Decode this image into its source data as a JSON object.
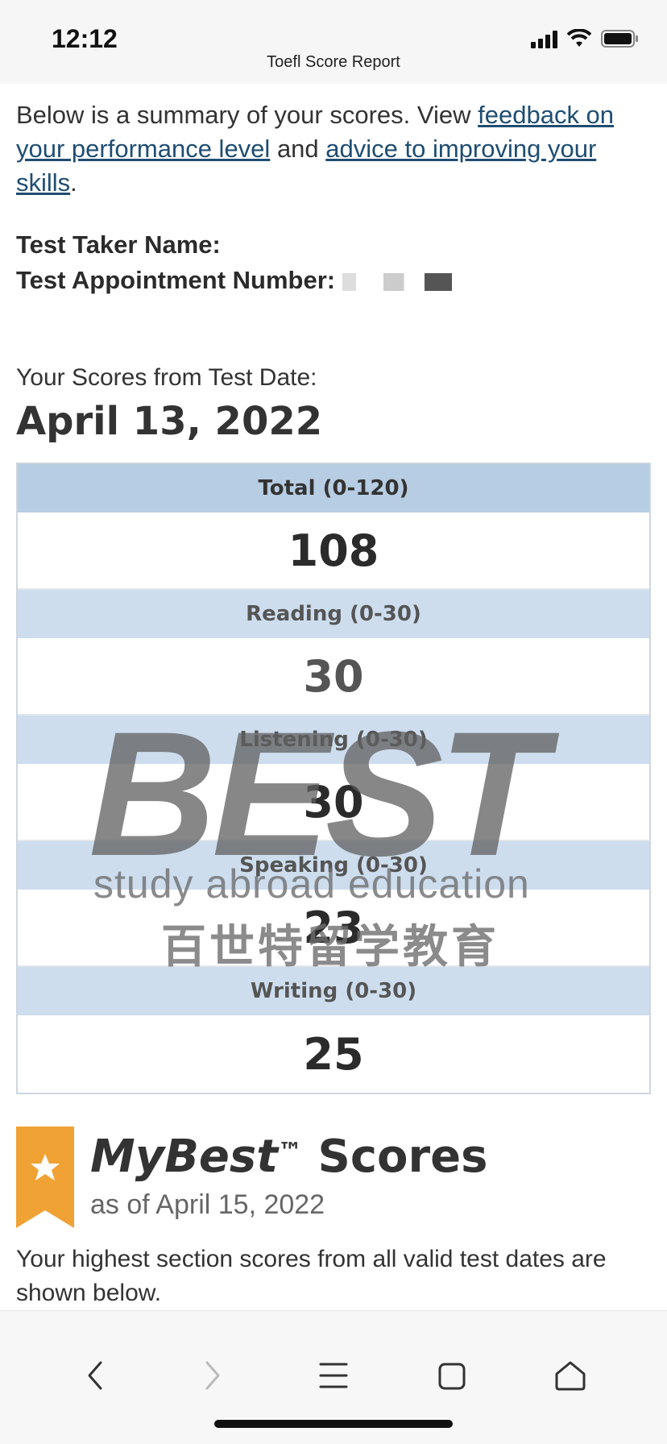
{
  "status": {
    "time": "12:12"
  },
  "browser": {
    "title": "Toefl Score Report"
  },
  "intro": {
    "text_before": "Below is a summary of your scores. View ",
    "link1": "feedback on your performance level",
    "text_mid": " and ",
    "link2": "advice to improving your skills",
    "text_end": "."
  },
  "taker": {
    "name_label": "Test Taker Name:",
    "appointment_label": "Test Appointment Number:"
  },
  "scores": {
    "from_label": "Your Scores from Test Date:",
    "test_date": "April 13, 2022",
    "total": {
      "label": "Total (0-120)",
      "value": "108"
    },
    "reading": {
      "label": "Reading (0-30)",
      "value": "30"
    },
    "listening": {
      "label": "Listening (0-30)",
      "value": "30"
    },
    "speaking": {
      "label": "Speaking (0-30)",
      "value": "23"
    },
    "writing": {
      "label": "Writing (0-30)",
      "value": "25"
    }
  },
  "watermark": {
    "big": "BEST",
    "en": "study abroad education",
    "cn": "百世特留学教育"
  },
  "mybest": {
    "title_italic": "MyBest",
    "tm": "™",
    "title_rest": " Scores",
    "as_of": "as of April 15, 2022",
    "description": "Your highest section scores from all valid test dates are shown below."
  },
  "toolbar": {
    "icons": [
      "back-icon",
      "forward-icon",
      "menu-icon",
      "tabs-icon",
      "home-icon"
    ]
  },
  "colors": {
    "header_band": "#b7cde3",
    "link": "#1f4d72",
    "ribbon": "#f0a234"
  }
}
